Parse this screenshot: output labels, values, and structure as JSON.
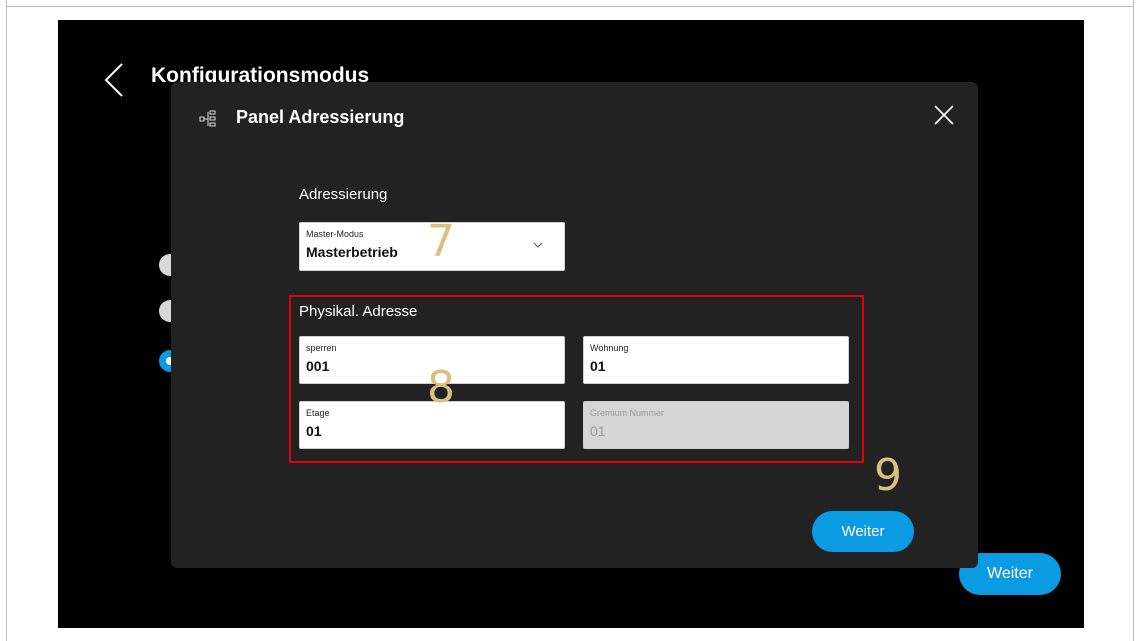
{
  "background": {
    "title": "Konfigurationsmodus",
    "weiter_label": "Weiter",
    "radios": [
      {
        "selected": false
      },
      {
        "selected": false
      },
      {
        "selected": true
      }
    ]
  },
  "dialog": {
    "title": "Panel Adressierung",
    "icon": "network-tree-icon",
    "addressing_heading": "Adressierung",
    "master_mode": {
      "label": "Master-Modus",
      "value": "Masterbetrieb"
    },
    "physical_heading": "Physikal. Adresse",
    "fields": {
      "sperren": {
        "label": "sperren",
        "value": "001"
      },
      "wohnung": {
        "label": "Wohnung",
        "value": "01"
      },
      "etage": {
        "label": "Etage",
        "value": "01"
      },
      "gremium": {
        "label": "Gremium Nummer",
        "value": "01",
        "disabled": true
      }
    },
    "weiter_label": "Weiter"
  },
  "annotations": {
    "marker_7": "7",
    "marker_8": "8",
    "marker_9": "9",
    "highlight_color": "#e0000a",
    "marker_color": "#d9c080"
  },
  "colors": {
    "accent": "#0a9be3",
    "dialog_bg": "#222222",
    "screen_bg": "#000000"
  }
}
